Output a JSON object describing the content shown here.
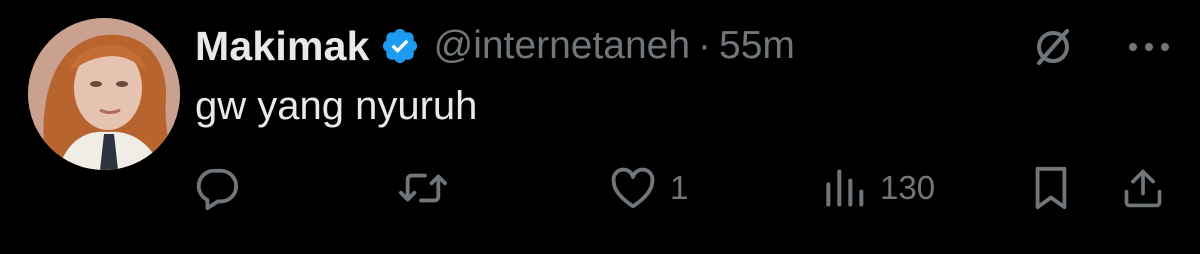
{
  "author": {
    "display_name": "Makimak",
    "handle": "@internetaneh",
    "separator": "·",
    "time": "55m",
    "verified": true
  },
  "tweet": {
    "text": "gw yang nyuruh"
  },
  "actions": {
    "reply_count": "",
    "retweet_count": "",
    "like_count": "1",
    "views_count": "130"
  },
  "icons": {
    "avatar": "avatar",
    "verified": "verified-badge-icon",
    "grok": "grok-icon",
    "more": "more-icon",
    "reply": "reply-icon",
    "retweet": "retweet-icon",
    "like": "like-icon",
    "views": "views-icon",
    "bookmark": "bookmark-icon",
    "share": "share-icon"
  },
  "colors": {
    "background": "#000000",
    "primary_text": "#e7e9ea",
    "secondary_text": "#71767b",
    "verified_blue": "#1d9bf0"
  }
}
